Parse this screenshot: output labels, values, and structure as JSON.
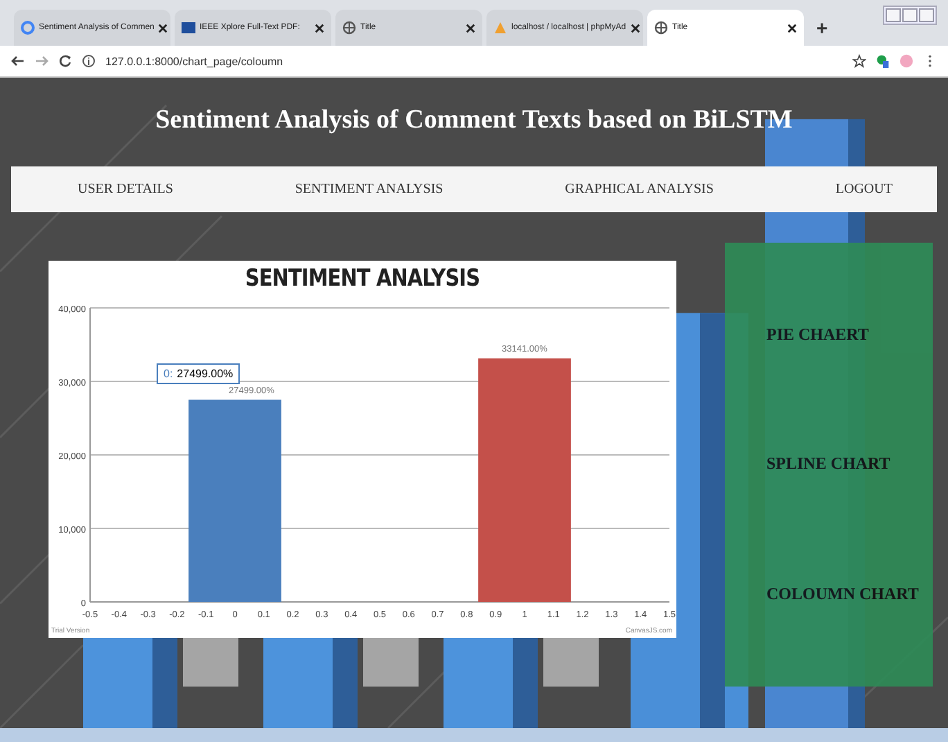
{
  "browser": {
    "tabs": [
      {
        "title": "Sentiment Analysis of Commen",
        "kind": "g",
        "selected": false
      },
      {
        "title": "IEEE Xplore Full-Text PDF:",
        "kind": "doc",
        "selected": false
      },
      {
        "title": "Title",
        "kind": "globe",
        "selected": false
      },
      {
        "title": "localhost / localhost | phpMyAd",
        "kind": "pma",
        "selected": false
      },
      {
        "title": "Title",
        "kind": "globe",
        "selected": true
      }
    ],
    "new_tab": "+",
    "address": "127.0.0.1:8000/chart_page/coloumn"
  },
  "page": {
    "title": "Sentiment Analysis of Comment Texts based on BiLSTM",
    "nav": [
      "USER DETAILS",
      "SENTIMENT ANALYSIS",
      "GRAPHICAL ANALYSIS",
      "LOGOUT"
    ],
    "chart": {
      "chart_data": {
        "type": "bar",
        "title": "SENTIMENT ANALYSIS",
        "x": [
          0,
          1
        ],
        "series": [
          {
            "color": "#4a7fbd",
            "values": [
              27499,
              null
            ]
          },
          {
            "color": "#c4504a",
            "values": [
              null,
              33141
            ]
          }
        ],
        "grid": true,
        "xlim": [
          -0.5,
          1.5
        ],
        "ylim": [
          0,
          40000
        ],
        "xticks": [
          {
            "value": -0.5,
            "label": "-0.5"
          },
          {
            "value": -0.4,
            "label": "-0.4"
          },
          {
            "value": -0.3,
            "label": "-0.3"
          },
          {
            "value": -0.2,
            "label": "-0.2"
          },
          {
            "value": -0.1,
            "label": "-0.1"
          },
          {
            "value": 0,
            "label": "0"
          },
          {
            "value": 0.1,
            "label": "0.1"
          },
          {
            "value": 0.2,
            "label": "0.2"
          },
          {
            "value": 0.3,
            "label": "0.3"
          },
          {
            "value": 0.4,
            "label": "0.4"
          },
          {
            "value": 0.5,
            "label": "0.5"
          },
          {
            "value": 0.6,
            "label": "0.6"
          },
          {
            "value": 0.7,
            "label": "0.7"
          },
          {
            "value": 0.8,
            "label": "0.8"
          },
          {
            "value": 0.9,
            "label": "0.9"
          },
          {
            "value": 1,
            "label": "1"
          },
          {
            "value": 1.1,
            "label": "1.1"
          },
          {
            "value": 1.2,
            "label": "1.2"
          },
          {
            "value": 1.3,
            "label": "1.3"
          },
          {
            "value": 1.4,
            "label": "1.4"
          },
          {
            "value": 1.5,
            "label": "1.5"
          }
        ],
        "yticks": [
          {
            "value": 0,
            "label": "0"
          },
          {
            "value": 10000,
            "label": "10,000"
          },
          {
            "value": 20000,
            "label": "20,000"
          },
          {
            "value": 30000,
            "label": "30,000"
          },
          {
            "value": 40000,
            "label": "40,000"
          }
        ],
        "value_labels": [
          "27499.00%",
          "33141.00%"
        ]
      },
      "tooltip": {
        "key": "0:",
        "value": "27499.00%"
      },
      "watermark_left": "Trial Version",
      "watermark_right": "CanvasJS.com"
    },
    "chart_links": [
      "PIE CHAERT",
      "SPLINE CHART",
      "COLOUMN CHART"
    ]
  }
}
